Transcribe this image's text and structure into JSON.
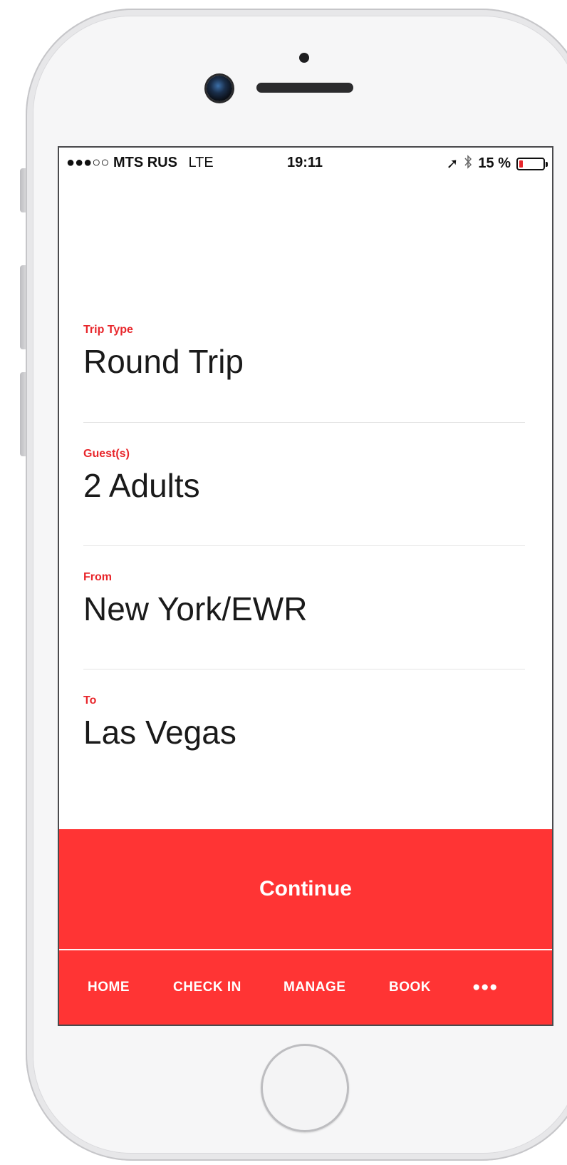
{
  "status_bar": {
    "signal": "●●●○○",
    "carrier": "MTS RUS",
    "network": "LTE",
    "time": "19:11",
    "location_icon": "➚",
    "bluetooth_icon": "bluetooth-icon",
    "battery_text": "15 %",
    "battery_level": 0.15,
    "battery_color": "#e8262b"
  },
  "form": {
    "trip_type": {
      "label": "Trip Type",
      "value": "Round Trip"
    },
    "guests": {
      "label": "Guest(s)",
      "value": "2 Adults"
    },
    "from": {
      "label": "From",
      "value": "New York/EWR"
    },
    "to": {
      "label": "To",
      "value": "Las Vegas"
    }
  },
  "continue_label": "Continue",
  "tabs": {
    "home": "HOME",
    "check_in": "CHECK IN",
    "manage": "MANAGE",
    "book": "BOOK",
    "more": "●●●"
  },
  "colors": {
    "accent": "#ff3434",
    "label": "#e8262b"
  }
}
